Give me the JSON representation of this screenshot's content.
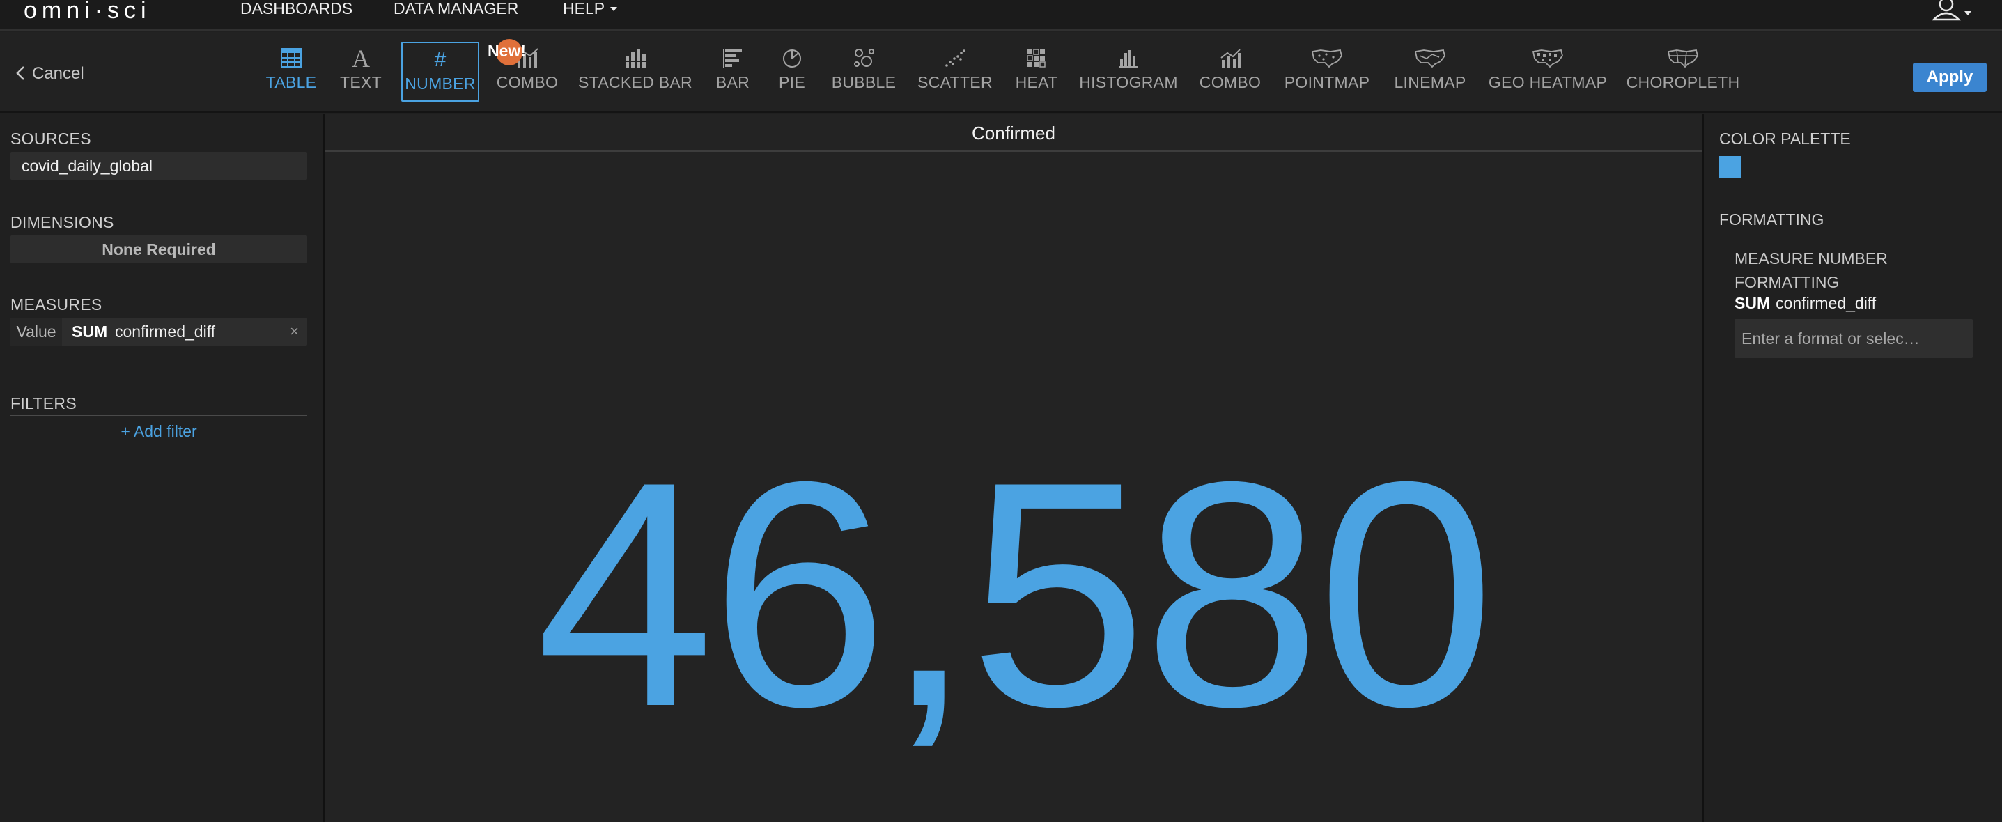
{
  "app": {
    "logo": "omni·sci",
    "nav": [
      "DASHBOARDS",
      "DATA MANAGER",
      "HELP"
    ]
  },
  "toolbar": {
    "cancel_label": "Cancel",
    "apply_label": "Apply",
    "new_badge": "New!",
    "chart_types": [
      {
        "label": "TABLE",
        "icon": "table-icon",
        "state": "hover"
      },
      {
        "label": "TEXT",
        "icon": "text-icon",
        "state": "normal"
      },
      {
        "label": "NUMBER",
        "icon": "number-icon",
        "state": "selected"
      },
      {
        "label": "COMBO",
        "icon": "combo-icon",
        "state": "normal"
      },
      {
        "label": "STACKED BAR",
        "icon": "stacked-bar-icon",
        "state": "normal"
      },
      {
        "label": "BAR",
        "icon": "bar-icon",
        "state": "normal"
      },
      {
        "label": "PIE",
        "icon": "pie-icon",
        "state": "normal"
      },
      {
        "label": "BUBBLE",
        "icon": "bubble-icon",
        "state": "normal"
      },
      {
        "label": "SCATTER",
        "icon": "scatter-icon",
        "state": "normal"
      },
      {
        "label": "HEAT",
        "icon": "heat-icon",
        "state": "normal"
      },
      {
        "label": "HISTOGRAM",
        "icon": "histogram-icon",
        "state": "normal"
      },
      {
        "label": "COMBO",
        "icon": "combo-icon",
        "state": "normal"
      },
      {
        "label": "POINTMAP",
        "icon": "pointmap-icon",
        "state": "normal"
      },
      {
        "label": "LINEMAP",
        "icon": "linemap-icon",
        "state": "normal"
      },
      {
        "label": "GEO HEATMAP",
        "icon": "geo-heatmap-icon",
        "state": "normal"
      },
      {
        "label": "CHOROPLETH",
        "icon": "choropleth-icon",
        "state": "normal"
      }
    ]
  },
  "left_panel": {
    "sources_title": "SOURCES",
    "source": "covid_daily_global",
    "dimensions_title": "DIMENSIONS",
    "dimensions_value": "None Required",
    "measures_title": "MEASURES",
    "measure": {
      "key": "Value",
      "agg": "SUM",
      "column": "confirmed_diff",
      "remove": "×"
    },
    "filters_title": "FILTERS",
    "add_filter": "+ Add filter"
  },
  "chart": {
    "title": "Confirmed",
    "value": "46,580"
  },
  "right_panel": {
    "color_palette_title": "COLOR PALETTE",
    "palette_color": "#4ba3e2",
    "formatting_title": "FORMATTING",
    "measure_number_line1": "MEASURE NUMBER",
    "measure_number_line2": "FORMATTING",
    "field_agg": "SUM",
    "field_column": "confirmed_diff",
    "format_placeholder": "Enter a format or selec…"
  },
  "colors": {
    "accent": "#4ba3e2",
    "apply_button": "#3b85d0",
    "badge": "#e0703a",
    "background": "#202020"
  }
}
